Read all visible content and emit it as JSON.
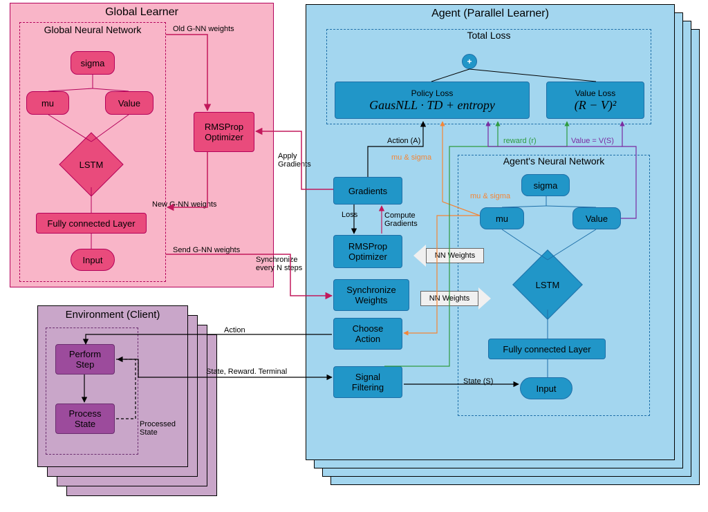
{
  "global": {
    "title": "Global Learner",
    "nn_title": "Global Neural Network",
    "sigma": "sigma",
    "mu": "mu",
    "value": "Value",
    "lstm": "LSTM",
    "fc": "Fully connected Layer",
    "input": "Input",
    "optimizer": "RMSProp\nOptimizer",
    "old_weights": "Old G-NN weights",
    "new_weights": "New G-NN weights",
    "send_weights": "Send G-NN weights",
    "apply_gradients": "Apply\nGradients",
    "sync_text": "Synchronize\nevery N steps"
  },
  "agent": {
    "title": "Agent (Parallel Learner)",
    "total_loss_title": "Total Loss",
    "policy_loss_title": "Policy Loss",
    "policy_loss_formula": "GausNLL · TD + entropy",
    "value_loss_title": "Value Loss",
    "value_loss_formula": "(R − V)²",
    "action_label": "Action (A)",
    "mu_sigma_label": "mu & sigma",
    "reward_label": "reward (r)",
    "value_eq_label": "Value = V(S)",
    "nn_title": "Agent's Neural Network",
    "gradients": "Gradients",
    "loss_label": "Loss",
    "compute_grad": "Compute\nGradients",
    "optimizer": "RMSProp\nOptimizer",
    "sync_weights": "Synchronize\nWeights",
    "choose_action": "Choose\nAction",
    "signal_filtering": "Signal\nFiltering",
    "nn_weights_left": "NN Weights",
    "nn_weights_right": "NN Weights",
    "state_label": "State (S)",
    "nn": {
      "sigma": "sigma",
      "mu": "mu",
      "value": "Value",
      "lstm": "LSTM",
      "fc": "Fully connected Layer",
      "input": "Input"
    }
  },
  "env": {
    "title": "Environment (Client)",
    "perform": "Perform\nStep",
    "process": "Process\nState",
    "processed_state": "Processed\nState",
    "action_label": "Action",
    "srt_label": "State, Reward. Terminal"
  },
  "colors": {
    "pink_bg": "#f9b5c8",
    "pink_border": "#b3005a",
    "pink_fill": "#e91e63",
    "blue_bg": "#a3d6ef",
    "blue_border": "#1e6fa8",
    "blue_fill": "#1e8cc3",
    "purple_bg": "#c9a6c9",
    "purple_border": "#6a2d6e",
    "purple_fill": "#9c4b9c",
    "orange": "#f58535",
    "green": "#2e9b3f",
    "purple_line": "#7a2aa0",
    "crimson": "#c2185b",
    "black": "#000000"
  }
}
